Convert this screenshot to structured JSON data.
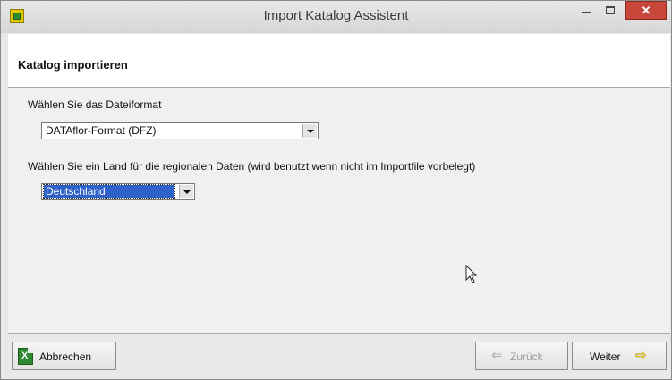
{
  "window": {
    "title": "Import Katalog Assistent",
    "close_glyph": "✕"
  },
  "header": {
    "title": "Katalog importieren"
  },
  "form": {
    "format_label": "Wählen Sie das Dateiformat",
    "format_value": "DATAflor-Format (DFZ)",
    "country_label": "Wählen Sie ein Land für die regionalen Daten (wird benutzt wenn nicht im Importfile vorbelegt)",
    "country_value": "Deutschland"
  },
  "footer": {
    "cancel_label": "Abbrechen",
    "back_label": "Zurück",
    "next_label": "Weiter"
  },
  "icons": {
    "app": "app-icon",
    "cancel": "excel-cancel-icon",
    "back": "arrow-left-icon",
    "next": "arrow-right-icon",
    "dropdown": "chevron-down-icon"
  },
  "colors": {
    "selection": "#2e62c8",
    "close_button": "#c7473a",
    "next_arrow": "#e8c400"
  }
}
